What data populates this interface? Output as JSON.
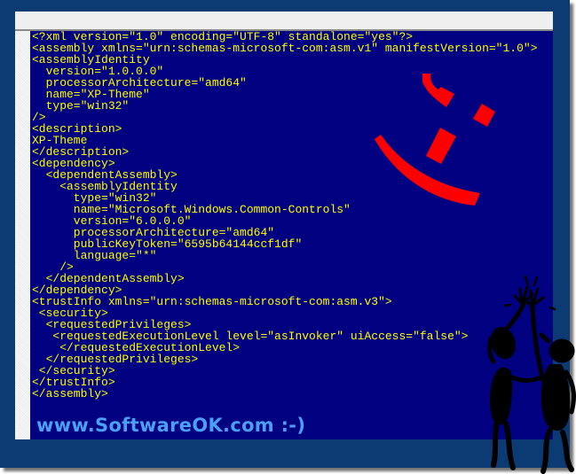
{
  "window": {
    "title": ""
  },
  "editor": {
    "text_color": "#ffff00",
    "background_color": "#000080",
    "lines": [
      "<?xml version=\"1.0\" encoding=\"UTF-8\" standalone=\"yes\"?>",
      "<assembly xmlns=\"urn:schemas-microsoft-com:asm.v1\" manifestVersion=\"1.0\">",
      "<assemblyIdentity",
      "  version=\"1.0.0.0\"",
      "  processorArchitecture=\"amd64\"",
      "  name=\"XP-Theme\"",
      "  type=\"win32\"",
      "/>",
      "<description>",
      "XP-Theme",
      "</description>",
      "<dependency>",
      "  <dependentAssembly>",
      "    <assemblyIdentity",
      "      type=\"win32\"",
      "      name=\"Microsoft.Windows.Common-Controls\"",
      "      version=\"6.0.0.0\"",
      "      processorArchitecture=\"amd64\"",
      "      publicKeyToken=\"6595b64144ccf1df\"",
      "      language=\"*\"",
      "    />",
      "  </dependentAssembly>",
      "</dependency>",
      "<trustInfo xmlns=\"urn:schemas-microsoft-com:asm.v3\">",
      " <security>",
      "  <requestedPrivileges>",
      "   <requestedExecutionLevel level=\"asInvoker\" uiAccess=\"false\">",
      "    </requestedExecutionLevel>",
      "  </requestedPrivileges>",
      " </security>",
      "</trustInfo>",
      "</assembly>"
    ]
  },
  "watermark": {
    "text": "www.SoftwareOK.com :-)",
    "color": "#4aa0f5"
  },
  "decorations": {
    "smiley_icon": "winking-smiley",
    "smiley_color": "#ff0000",
    "figures_icon": "dancing-figures-silhouette",
    "figures_color": "#000000"
  },
  "colors": {
    "frame": "#0b3b72",
    "titlebar": "#efefef"
  }
}
